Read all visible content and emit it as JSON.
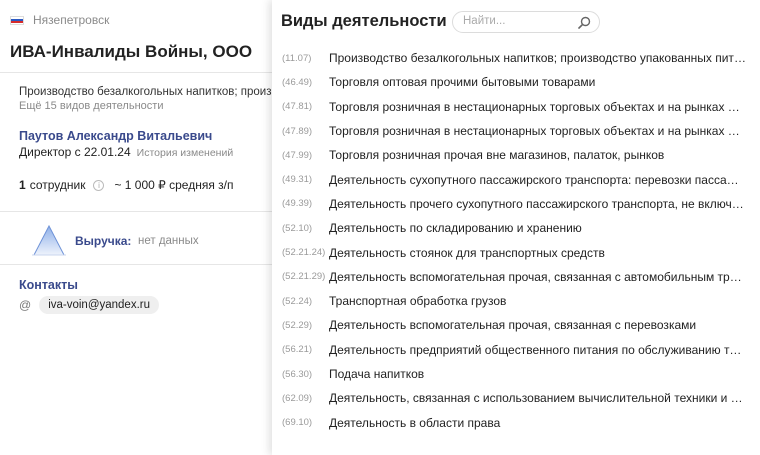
{
  "company_card": {
    "region": "Нязепетровск",
    "name": "ИВА-Инвалиды Войны, ООО",
    "activity_preview": "Производство безалкогольных напитков; производство упакованных питьевых вод",
    "more_activities": "Ещё 15 видов деятельности",
    "director": {
      "name": "Паутов Александр Витальевич",
      "role": "Директор с 22.01.24",
      "history_link": "История изменений"
    },
    "employees_count": "1",
    "employees_label": "сотрудник",
    "avg_salary": "~ 1 000 ₽ средняя з/п",
    "revenue_label": "Выручка:",
    "revenue_value": "нет данных",
    "contacts_title": "Контакты",
    "email": "iva-voin@yandex.ru"
  },
  "activities_panel": {
    "title": "Виды деятельности",
    "search_placeholder": "Найти...",
    "items": [
      {
        "code": "(11.07)",
        "name": "Производство безалкогольных напитков; производство упакованных питьевых вод"
      },
      {
        "code": "(46.49)",
        "name": "Торговля оптовая прочими бытовыми товарами"
      },
      {
        "code": "(47.81)",
        "name": "Торговля розничная в нестационарных торговых объектах и на рынках пищевыми продуктами"
      },
      {
        "code": "(47.89)",
        "name": "Торговля розничная в нестационарных торговых объектах и на рынках прочими товарами"
      },
      {
        "code": "(47.99)",
        "name": "Торговля розничная прочая вне магазинов, палаток, рынков"
      },
      {
        "code": "(49.31)",
        "name": "Деятельность сухопутного пассажирского транспорта: перевозки пассажиров"
      },
      {
        "code": "(49.39)",
        "name": "Деятельность прочего сухопутного пассажирского транспорта, не включенная в другие группировки"
      },
      {
        "code": "(52.10)",
        "name": "Деятельность по складированию и хранению"
      },
      {
        "code": "(52.21.24)",
        "name": "Деятельность стоянок для транспортных средств"
      },
      {
        "code": "(52.21.29)",
        "name": "Деятельность вспомогательная прочая, связанная с автомобильным транспортом"
      },
      {
        "code": "(52.24)",
        "name": "Транспортная обработка грузов"
      },
      {
        "code": "(52.29)",
        "name": "Деятельность вспомогательная прочая, связанная с перевозками"
      },
      {
        "code": "(56.21)",
        "name": "Деятельность предприятий общественного питания по обслуживанию торжественных мероприятий"
      },
      {
        "code": "(56.30)",
        "name": "Подача напитков"
      },
      {
        "code": "(62.09)",
        "name": "Деятельность, связанная с использованием вычислительной техники и информационных технологий"
      },
      {
        "code": "(69.10)",
        "name": "Деятельность в области права"
      }
    ]
  }
}
